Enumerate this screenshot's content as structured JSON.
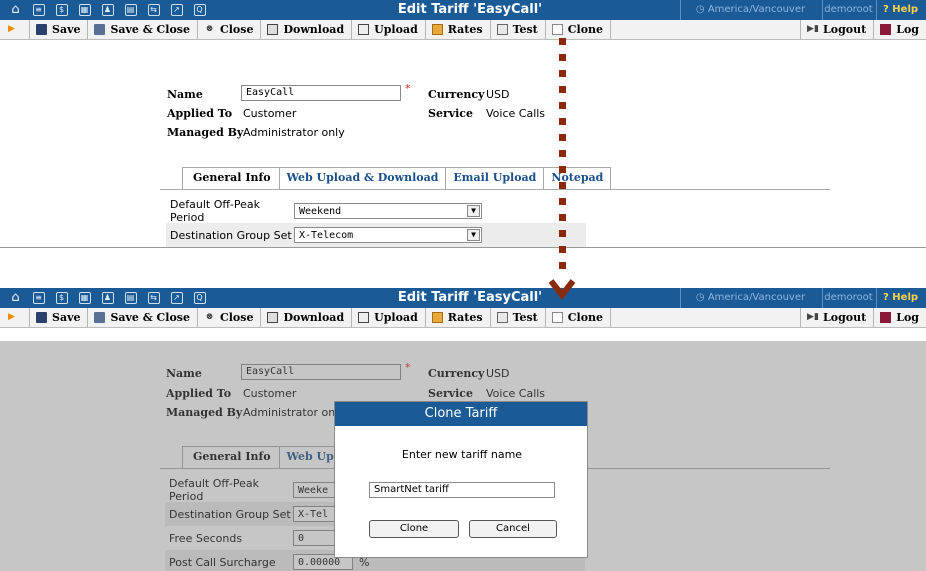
{
  "nav_icons": [
    "home-icon",
    "list-icon",
    "dollar-icon",
    "grid-icon",
    "user-icon",
    "tariff-icon",
    "routing-icon",
    "chart-icon",
    "search-icon"
  ],
  "glyphs": {
    "home": "⌂",
    "list": "≡",
    "dollar": "$",
    "grid": "▦",
    "user": "♟",
    "tariff": "▤",
    "routing": "⇆",
    "chart": "↗",
    "search": "Q",
    "tz": "◷",
    "help": "?"
  },
  "window": {
    "title": "Edit Tariff 'EasyCall'",
    "timezone": "America/Vancouver",
    "user": "demoroot",
    "help": "Help"
  },
  "toolbar": {
    "save": "Save",
    "save_close": "Save & Close",
    "close": "Close",
    "download": "Download",
    "upload": "Upload",
    "rates": "Rates",
    "test": "Test",
    "clone": "Clone",
    "logout": "Logout",
    "log": "Log"
  },
  "form": {
    "name_label": "Name",
    "name_value": "EasyCall",
    "required_mark": "*",
    "applied_to_label": "Applied To",
    "applied_to_value": "Customer",
    "managed_by_label": "Managed By",
    "managed_by_value": "Administrator only",
    "currency_label": "Currency",
    "currency_value": "USD",
    "service_label": "Service",
    "service_value": "Voice Calls"
  },
  "tabs": [
    "General Info",
    "Web Upload & Download",
    "Email Upload",
    "Notepad"
  ],
  "tabs_bottom": [
    "General Info",
    "Web Upload"
  ],
  "general": {
    "off_peak_label": "Default Off-Peak Period",
    "off_peak_value": "Weekend",
    "off_peak_value_trunc": "Weeke",
    "dest_group_label": "Destination Group Set",
    "dest_group_value": "X-Telecom",
    "dest_group_value_trunc": "X-Tel",
    "free_seconds_label": "Free Seconds",
    "free_seconds_value": "0",
    "post_call_label": "Post Call Surcharge",
    "post_call_value": "0.00000",
    "post_call_unit": "%"
  },
  "dialog": {
    "title": "Clone Tariff",
    "prompt": "Enter new tariff name",
    "input_value": "SmartNet tariff",
    "clone_button": "Clone",
    "cancel_button": "Cancel"
  },
  "colors": {
    "brand": "#1a5a96",
    "arrow": "#8a2a0a",
    "timezone_text": "#8fb6de",
    "help_text": "#ffd24a"
  }
}
